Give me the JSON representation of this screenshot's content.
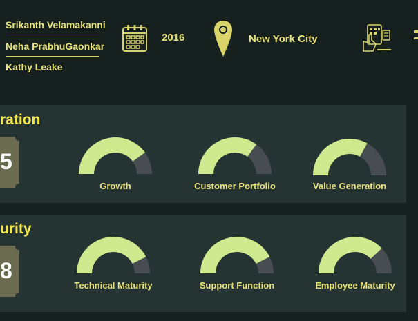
{
  "authors": [
    "Srikanth Velamakanni",
    "Neha PrabhuGaonkar",
    "Kathy Leake"
  ],
  "header": {
    "year": "2016",
    "location": "New York City",
    "icons": {
      "date": "calendar-icon",
      "location": "map-pin-icon",
      "tech": "tablet-hand-icon"
    }
  },
  "colors": {
    "background": "#16201f",
    "panel": "#263333",
    "accent_yellow": "#f2e64a",
    "label_yellow": "#e8e27a",
    "gauge_fill": "#cfe98f",
    "gauge_track": "#484d51",
    "badge": "#6b6c4f"
  },
  "sections": [
    {
      "title": "ration",
      "score": "5",
      "gauges": [
        {
          "label": "Growth",
          "value": 0.8
        },
        {
          "label": "Customer Portfolio",
          "value": 0.7
        },
        {
          "label": "Value Generation",
          "value": 0.66
        }
      ]
    },
    {
      "title": "urity",
      "score": "8",
      "gauges": [
        {
          "label": "Technical Maturity",
          "value": 0.85
        },
        {
          "label": "Support Function",
          "value": 0.85
        },
        {
          "label": "Employee Maturity",
          "value": 0.76
        }
      ]
    }
  ]
}
